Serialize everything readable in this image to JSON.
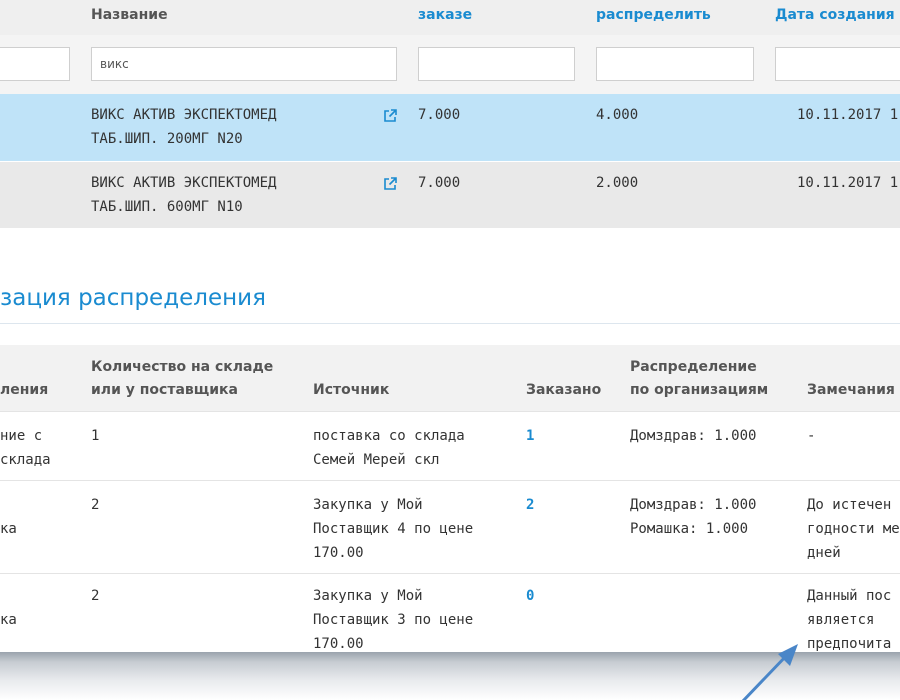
{
  "table1": {
    "headers": {
      "name": "Название",
      "ordered": "заказе",
      "distribute": "распределить",
      "created": "Дата создания"
    },
    "filters": {
      "name_value": "викс"
    },
    "rows": [
      {
        "name_line1": "ВИКС АКТИВ ЭКСПЕКТОМЕД",
        "name_line2": "ТАБ.ШИП. 200МГ N20",
        "ordered": "7.000",
        "distribute": "4.000",
        "created": "10.11.2017 1"
      },
      {
        "name_line1": "ВИКС АКТИВ ЭКСПЕКТОМЕД",
        "name_line2": "ТАБ.ШИП. 600МГ N10",
        "ordered": "7.000",
        "distribute": "2.000",
        "created": "10.11.2017 1"
      }
    ]
  },
  "section_title": "зация распределения",
  "table2": {
    "headers": {
      "col0": "ления",
      "qty_line1": "Количество на складе",
      "qty_line2": "или у поставщика",
      "source": "Источник",
      "ordered": "Заказано",
      "dist_line1": "Распределение",
      "dist_line2": "по организациям",
      "remarks": "Замечания"
    },
    "rows": [
      {
        "c0_line1": "ние с",
        "c0_line2": "склада",
        "qty": "1",
        "source_line1": "поставка со склада",
        "source_line2": "Семей Мерей скл",
        "source_line3": "",
        "ordered": "1",
        "dist_line1": "Домздрав: 1.000",
        "dist_line2": "",
        "remark_line1": "-",
        "remark_line2": "",
        "remark_line3": ""
      },
      {
        "c0_line1": "",
        "c0_line2": "ка",
        "qty": "2",
        "source_line1": "Закупка у Мой",
        "source_line2": "Поставщик 4 по цене",
        "source_line3": "170.00",
        "ordered": "2",
        "dist_line1": "Домздрав: 1.000",
        "dist_line2": "Ромашка: 1.000",
        "remark_line1": "До истечен",
        "remark_line2": "годности ме",
        "remark_line3": "дней"
      },
      {
        "c0_line1": "",
        "c0_line2": "ка",
        "qty": "2",
        "source_line1": "Закупка у Мой",
        "source_line2": "Поставщик 3 по цене",
        "source_line3": "170.00",
        "ordered": "0",
        "dist_line1": "",
        "dist_line2": "",
        "remark_line1": "Данный пос",
        "remark_line2": "является",
        "remark_line3": "предпочита"
      }
    ]
  },
  "colors": {
    "accent": "#1a8bd0",
    "selected_row": "#bfe3f8",
    "arrow": "#4a86c8"
  },
  "icons": {
    "external_link": "external-link-icon",
    "annotation_arrow": "arrow-icon"
  }
}
